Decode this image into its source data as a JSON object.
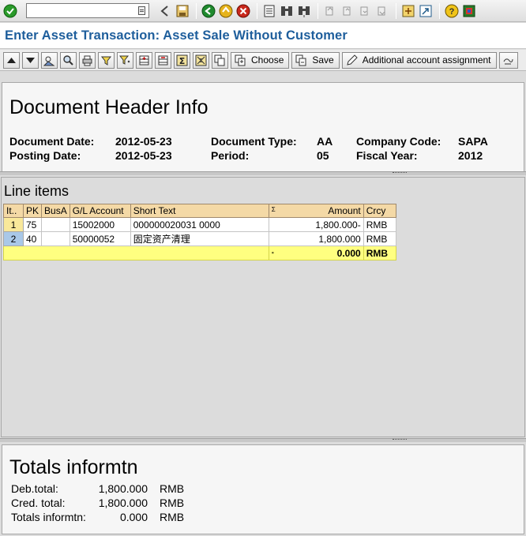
{
  "window": {
    "title": "Enter Asset Transaction: Asset Sale Without Customer",
    "command_field": {
      "value": "",
      "placeholder": ""
    }
  },
  "system_toolbar": {
    "icons": [
      "back-icon",
      "save-icon",
      "green-back-icon",
      "exit-icon",
      "cancel-icon",
      "print-icon",
      "find-icon",
      "find-next-icon",
      "first-page-icon",
      "previous-page-icon",
      "next-page-icon",
      "last-page-icon",
      "new-session-icon",
      "shortcut-icon",
      "help-icon",
      "customize-layout-icon"
    ]
  },
  "app_toolbar": {
    "choose_label": "Choose",
    "save_label": "Save",
    "additional_label": "Additional account assignment"
  },
  "header": {
    "title": "Document Header Info",
    "fields": {
      "document_date_label": "Document Date:",
      "document_date_value": "2012-05-23",
      "posting_date_label": "Posting Date:",
      "posting_date_value": "2012-05-23",
      "document_type_label": "Document Type:",
      "document_type_value": "AA",
      "period_label": "Period:",
      "period_value": "05",
      "company_code_label": "Company Code:",
      "company_code_value": "SAPA",
      "fiscal_year_label": "Fiscal Year:",
      "fiscal_year_value": "2012"
    }
  },
  "line_items": {
    "title": "Line items",
    "columns": [
      "It..",
      "PK",
      "BusA",
      "G/L Account",
      "Short Text",
      "Σ",
      "Amount",
      "Crcy"
    ],
    "rows": [
      {
        "item": "1",
        "pk": "75",
        "busa": "",
        "gl": "15002000",
        "text": "000000020031 0000",
        "amount": "1,800.000-",
        "crcy": "RMB"
      },
      {
        "item": "2",
        "pk": "40",
        "busa": "",
        "gl": "50000052",
        "text": "固定资产清理",
        "amount": "1,800.000",
        "crcy": "RMB"
      }
    ],
    "total": {
      "marker": "▪",
      "amount": "0.000",
      "crcy": "RMB"
    }
  },
  "totals": {
    "title": "Totals informtn",
    "rows": [
      {
        "label": "Deb.total:",
        "value": "1,800.000",
        "crcy": "RMB"
      },
      {
        "label": "Cred. total:",
        "value": "1,800.000",
        "crcy": "RMB"
      },
      {
        "label": "Totals informtn:",
        "value": "0.000",
        "crcy": "RMB"
      }
    ]
  },
  "colors": {
    "title_blue": "#1e5e9c",
    "column_header": "#f4d9a6",
    "total_row": "#ffff80",
    "row_selector_1": "#f9e89a",
    "row_selector_2": "#a9c8e8"
  }
}
